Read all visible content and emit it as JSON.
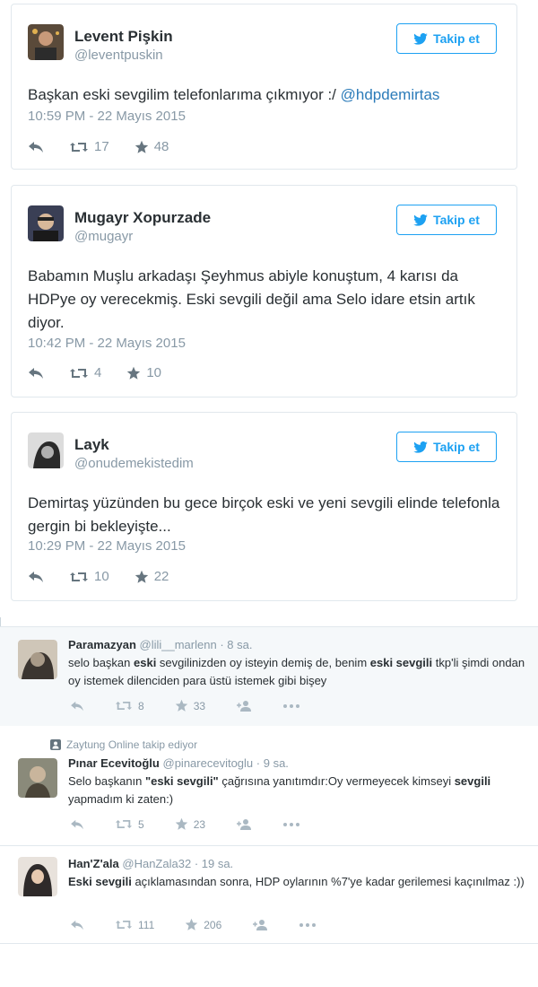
{
  "follow_label": "Takip et",
  "tweets": [
    {
      "name": "Levent Pişkin",
      "handle": "@leventpuskin",
      "text": "Başkan eski sevgilim telefonlarıma çıkmıyor :/ ",
      "mention": "@hdpdemirtas",
      "time": "10:59 PM - 22 Mayıs 2015",
      "retweets": "17",
      "likes": "48"
    },
    {
      "name": "Mugayr Xopurzade",
      "handle": "@mugayr",
      "text": "Babamın Muşlu arkadaşı Şeyhmus abiyle konuştum, 4 karısı da HDPye oy verecekmiş. Eski sevgili değil ama Selo idare etsin artık diyor.",
      "time": "10:42 PM - 22 Mayıs 2015",
      "retweets": "4",
      "likes": "10"
    },
    {
      "name": "Layk",
      "handle": "@onudemekistedim",
      "text": "Demirtaş yüzünden bu gece birçok eski ve yeni sevgili elinde telefonla gergin bi bekleyişte...",
      "time": "10:29 PM - 22 Mayıs 2015",
      "retweets": "10",
      "likes": "22"
    }
  ],
  "small_tweets": [
    {
      "name": "Paramazyan",
      "handle": "@lili__marlenn",
      "age": "· 8 sa.",
      "text_parts": [
        "selo başkan ",
        "eski",
        " sevgilinizden oy isteyin demiş de, benim ",
        "eski sevgili",
        " tkp'li şimdi ondan oy istemek dilenciden para üstü istemek gibi bişey"
      ],
      "retweets": "8",
      "likes": "33"
    },
    {
      "context": "Zaytung Online takip ediyor",
      "name": "Pınar Ecevitoğlu",
      "handle": "@pinarecevitoglu",
      "age": "· 9 sa.",
      "text_parts": [
        "Selo başkanın ",
        "\"eski sevgili\"",
        " çağrısına yanıtımdır:Oy vermeyecek kimseyi ",
        "sevgili",
        " yapmadım ki zaten:)"
      ],
      "retweets": "5",
      "likes": "23"
    },
    {
      "name": "Han'Z'ala",
      "handle": "@HanZala32",
      "age": "· 19 sa.",
      "text_parts": [
        "",
        "Eski sevgili",
        " açıklamasından sonra, HDP oylarının %7'ye kadar gerilemesi kaçınılmaz :))",
        "",
        ""
      ],
      "retweets": "111",
      "likes": "206"
    }
  ],
  "colors": {
    "accent": "#1da1f2",
    "link": "#2b7bb9",
    "gray": "#8899a6"
  }
}
